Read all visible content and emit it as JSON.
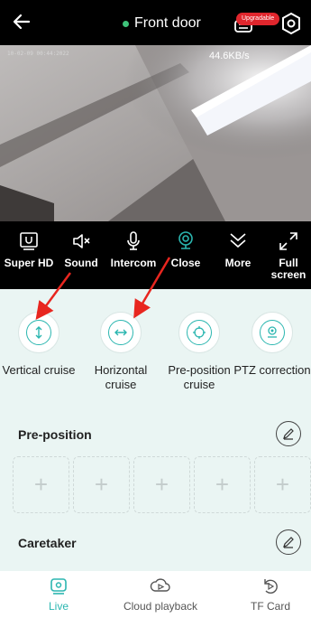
{
  "header": {
    "title": "Front door",
    "badge": "Upgradable",
    "status_color": "#3ec37a"
  },
  "video": {
    "timestamp": "10-02-09 00:44:2022",
    "speed": "44.6KB/s"
  },
  "controls": [
    {
      "label": "Super HD",
      "icon": "hd-icon"
    },
    {
      "label": "Sound",
      "icon": "muted-speaker-icon"
    },
    {
      "label": "Intercom",
      "icon": "microphone-icon"
    },
    {
      "label": "Close",
      "icon": "camera-icon",
      "active": true
    },
    {
      "label": "More",
      "icon": "chevron-down-icon"
    },
    {
      "label": "Full screen",
      "icon": "expand-icon"
    }
  ],
  "features": [
    {
      "label": "Vertical cruise",
      "icon": "vertical-arrows-icon"
    },
    {
      "label": "Horizontal cruise",
      "icon": "horizontal-arrows-icon"
    },
    {
      "label": "Pre-position cruise",
      "icon": "crosshair-icon"
    },
    {
      "label": "PTZ correction",
      "icon": "ptz-icon"
    }
  ],
  "preposition": {
    "title": "Pre-position",
    "slots": [
      "+",
      "+",
      "+",
      "+",
      "+"
    ]
  },
  "caretaker": {
    "title": "Caretaker"
  },
  "bottom_nav": [
    {
      "label": "Live",
      "icon": "live-icon",
      "active": true
    },
    {
      "label": "Cloud playback",
      "icon": "cloud-playback-icon"
    },
    {
      "label": "TF Card",
      "icon": "tf-card-icon"
    }
  ],
  "colors": {
    "accent": "#2bb6b0",
    "badge": "#e0262d",
    "annotation": "#e8261f"
  }
}
